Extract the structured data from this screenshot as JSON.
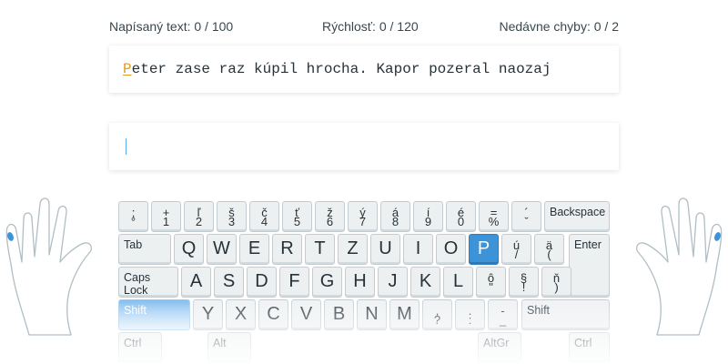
{
  "stats": {
    "typed": "Napísaný text: 0 / 100",
    "speed": "Rýchlosť: 0 / 120",
    "errors": "Nedávne chyby: 0 / 2"
  },
  "target": {
    "current_char": "P",
    "rest": "eter zase raz kúpil hrocha. Kapor pozeral naozaj"
  },
  "input": {
    "value": ""
  },
  "keyboard": {
    "rows": [
      [
        {
          "top": ";",
          "bot": "°"
        },
        {
          "top": "+",
          "bot": "1"
        },
        {
          "top": "ľ",
          "bot": "2"
        },
        {
          "top": "š",
          "bot": "3"
        },
        {
          "top": "č",
          "bot": "4"
        },
        {
          "top": "ť",
          "bot": "5"
        },
        {
          "top": "ž",
          "bot": "6"
        },
        {
          "top": "ý",
          "bot": "7"
        },
        {
          "top": "á",
          "bot": "8"
        },
        {
          "top": "í",
          "bot": "9"
        },
        {
          "top": "é",
          "bot": "0"
        },
        {
          "top": "=",
          "bot": "%"
        },
        {
          "top": "´",
          "bot": "ˇ"
        },
        {
          "word": "Backspace"
        }
      ],
      [
        {
          "word": "Tab"
        },
        {
          "main": "Q"
        },
        {
          "main": "W"
        },
        {
          "main": "E"
        },
        {
          "main": "R"
        },
        {
          "main": "T"
        },
        {
          "main": "Z"
        },
        {
          "main": "U"
        },
        {
          "main": "I"
        },
        {
          "main": "O"
        },
        {
          "main": "P",
          "highlight": true
        },
        {
          "top": "ú",
          "bot": "/"
        },
        {
          "top": "ä",
          "bot": "("
        },
        {
          "word": "Enter"
        }
      ],
      [
        {
          "word": "Caps Lock"
        },
        {
          "main": "A"
        },
        {
          "main": "S"
        },
        {
          "main": "D"
        },
        {
          "main": "F"
        },
        {
          "main": "G"
        },
        {
          "main": "H"
        },
        {
          "main": "J"
        },
        {
          "main": "K"
        },
        {
          "main": "L"
        },
        {
          "top": "ô",
          "bot": "\""
        },
        {
          "top": "§",
          "bot": "!"
        },
        {
          "top": "ň",
          "bot": ")"
        }
      ],
      [
        {
          "word": "Shift",
          "highlight": true
        },
        {
          "main": "Y"
        },
        {
          "main": "X"
        },
        {
          "main": "C"
        },
        {
          "main": "V"
        },
        {
          "main": "B"
        },
        {
          "main": "N"
        },
        {
          "main": "M"
        },
        {
          "top": ",",
          "bot": "?"
        },
        {
          "top": ".",
          "bot": ":"
        },
        {
          "top": "-",
          "bot": "_"
        },
        {
          "word": "Shift"
        }
      ],
      [
        {
          "word": "Ctrl"
        },
        {
          "word": "Alt"
        },
        {
          "word": "AltGr"
        },
        {
          "word": "Ctrl"
        }
      ]
    ]
  },
  "colors": {
    "accent": "#3d93d8",
    "current_char": "#e09b1a",
    "finger_tip": "#3d93d8"
  },
  "hands": {
    "active_finger": "pinky"
  }
}
